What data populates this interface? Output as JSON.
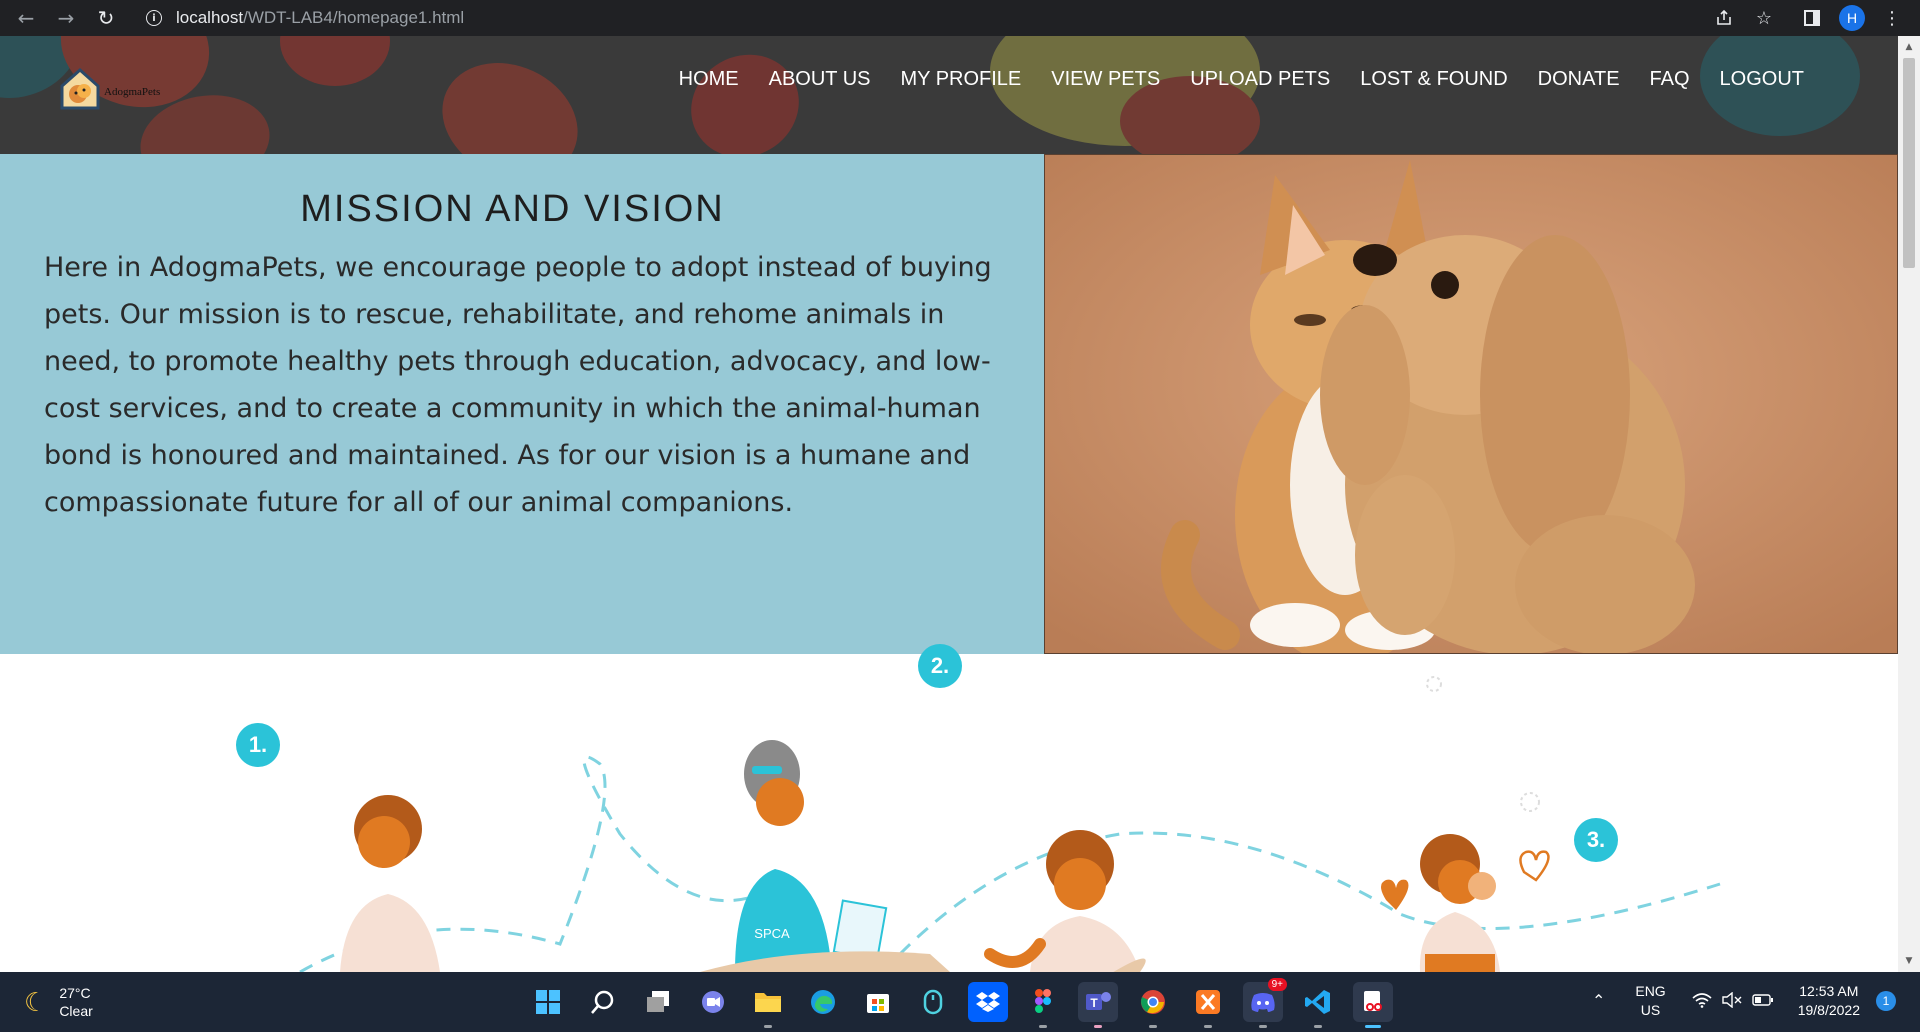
{
  "browser": {
    "url_host": "localhost",
    "url_path": "/WDT-LAB4/homepage1.html",
    "profile_initial": "H"
  },
  "site": {
    "logo_text": "AdogmaPets",
    "menu": [
      "HOME",
      "ABOUT US",
      "MY PROFILE",
      "VIEW PETS",
      "UPLOAD PETS",
      "LOST & FOUND",
      "DONATE",
      "FAQ",
      "LOGOUT"
    ],
    "mission_title": "MISSION AND VISION",
    "mission_text": "Here in AdogmaPets, we encourage people to adopt instead of buying pets. Our mission is to rescue, rehabilitate, and rehome animals in need, to promote healthy pets through education, advocacy, and low-cost services, and to create a community in which the animal-human bond is honoured and maintained. As for our vision is a humane and compassionate future for all of our animal companions.",
    "illustration": {
      "steps": [
        "1.",
        "2.",
        "3."
      ],
      "shirt_label": "SPCA"
    }
  },
  "taskbar": {
    "weather_temp": "27°C",
    "weather_desc": "Clear",
    "lang_primary": "ENG",
    "lang_region": "US",
    "time": "12:53 AM",
    "date": "19/8/2022",
    "notification_count": "1",
    "discord_badge": "9+"
  },
  "colors": {
    "mission_bg": "#97c9d6",
    "header_bg": "#3a3a3a",
    "step_badge": "#2bc3d8",
    "taskbar_bg": "#1c2636"
  }
}
